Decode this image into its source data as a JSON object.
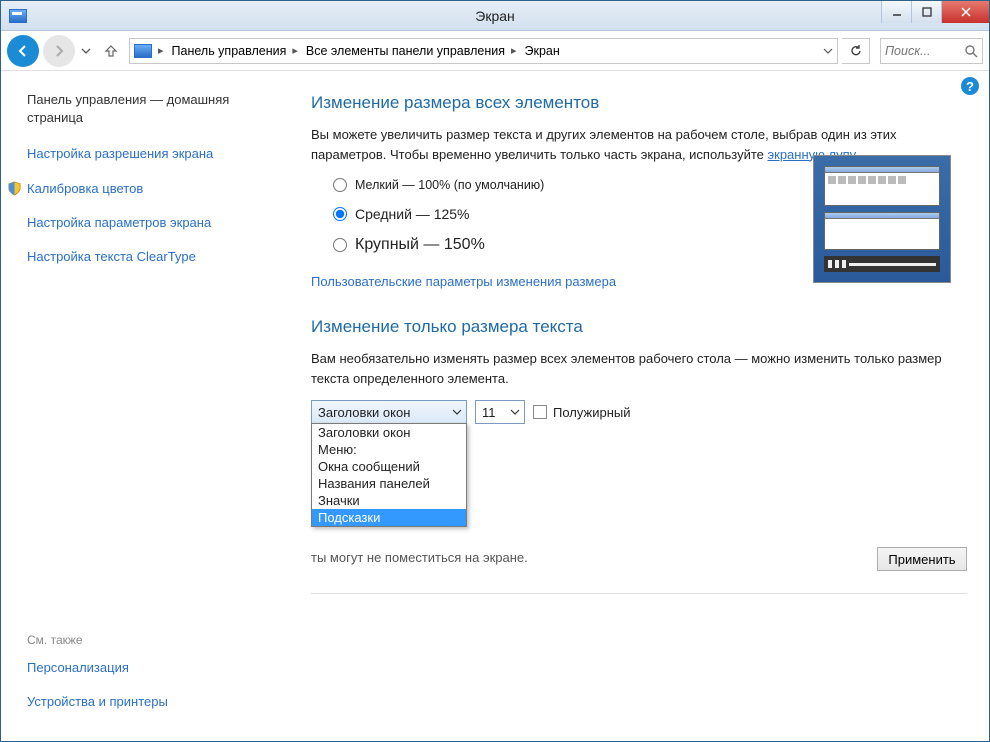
{
  "window": {
    "title": "Экран"
  },
  "breadcrumb": {
    "items": [
      "Панель управления",
      "Все элементы панели управления",
      "Экран"
    ]
  },
  "search": {
    "placeholder": "Поиск..."
  },
  "sidebar": {
    "home": "Панель управления — домашняя страница",
    "links": [
      "Настройка разрешения экрана",
      "Калибровка цветов",
      "Настройка параметров экрана",
      "Настройка текста ClearType"
    ],
    "also_title": "См. также",
    "also_links": [
      "Персонализация",
      "Устройства и принтеры"
    ]
  },
  "section1": {
    "title": "Изменение размера всех элементов",
    "desc_pre": "Вы можете увеличить размер текста и других элементов на рабочем столе, выбрав один из этих параметров. Чтобы временно увеличить только часть экрана, используйте ",
    "desc_link": "экранную лупу",
    "desc_post": ".",
    "radios": [
      "Мелкий — 100% (по умолчанию)",
      "Средний — 125%",
      "Крупный — 150%"
    ],
    "radio_selected": 1,
    "custom_link": "Пользовательские параметры изменения размера"
  },
  "section2": {
    "title": "Изменение только размера текста",
    "desc": "Вам необязательно изменять размер всех элементов рабочего стола — можно изменить только размер текста определенного элемента.",
    "combo_value": "Заголовки окон",
    "combo_options": [
      "Заголовки окон",
      "Меню:",
      "Окна сообщений",
      "Названия панелей",
      "Значки",
      "Подсказки"
    ],
    "combo_highlight": 5,
    "size_value": "11",
    "bold_label": "Полужирный",
    "warning_suffix": "ты могут не поместиться на экране.",
    "apply": "Применить"
  }
}
